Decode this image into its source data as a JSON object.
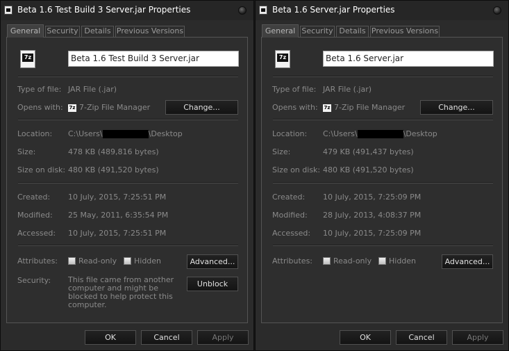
{
  "windows": [
    {
      "title": "Beta 1.6 Test Build 3 Server.jar Properties",
      "tabs": [
        "General",
        "Security",
        "Details",
        "Previous Versions"
      ],
      "file_icon_label": "7z",
      "filename": "Beta 1.6 Test Build 3 Server.jar",
      "type_label": "Type of file:",
      "type_value": "JAR File (.jar)",
      "opens_label": "Opens with:",
      "opens_value": "7-Zip File Manager",
      "change_button": "Change...",
      "location_label": "Location:",
      "location_prefix": "C:\\Users\\",
      "location_suffix": "\\Desktop",
      "size_label": "Size:",
      "size_value": "478 KB (489,816 bytes)",
      "size_on_disk_label": "Size on disk:",
      "size_on_disk_value": "480 KB (491,520 bytes)",
      "created_label": "Created:",
      "created_value": "10 July, 2015, 7:25:51 PM",
      "modified_label": "Modified:",
      "modified_value": "25 May, 2011, 6:35:54 PM",
      "accessed_label": "Accessed:",
      "accessed_value": "10 July, 2015, 7:25:51 PM",
      "attributes_label": "Attributes:",
      "readonly_label": "Read-only",
      "hidden_label": "Hidden",
      "advanced_button": "Advanced...",
      "security_label": "Security:",
      "security_text": "This file came from another computer and might be blocked to help protect this computer.",
      "unblock_button": "Unblock",
      "ok_button": "OK",
      "cancel_button": "Cancel",
      "apply_button": "Apply"
    },
    {
      "title": "Beta 1.6 Server.jar Properties",
      "tabs": [
        "General",
        "Security",
        "Details",
        "Previous Versions"
      ],
      "file_icon_label": "7z",
      "filename": "Beta 1.6 Server.jar",
      "type_label": "Type of file:",
      "type_value": "JAR File (.jar)",
      "opens_label": "Opens with:",
      "opens_value": "7-Zip File Manager",
      "change_button": "Change...",
      "location_label": "Location:",
      "location_prefix": "C:\\Users\\",
      "location_suffix": "\\Desktop",
      "size_label": "Size:",
      "size_value": "479 KB (491,437 bytes)",
      "size_on_disk_label": "Size on disk:",
      "size_on_disk_value": "480 KB (491,520 bytes)",
      "created_label": "Created:",
      "created_value": "10 July, 2015, 7:25:09 PM",
      "modified_label": "Modified:",
      "modified_value": "28 July, 2013, 4:08:37 PM",
      "accessed_label": "Accessed:",
      "accessed_value": "10 July, 2015, 7:25:09 PM",
      "attributes_label": "Attributes:",
      "readonly_label": "Read-only",
      "hidden_label": "Hidden",
      "advanced_button": "Advanced...",
      "ok_button": "OK",
      "cancel_button": "Cancel",
      "apply_button": "Apply"
    }
  ]
}
